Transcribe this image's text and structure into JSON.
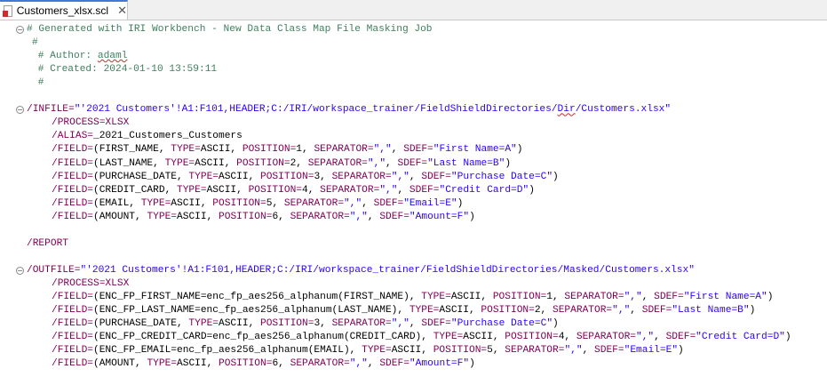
{
  "tab": {
    "filename": "Customers_xlsx.scl",
    "close_glyph": "✕",
    "file_icon": "file-scl-icon"
  },
  "editor": {
    "lines": [
      {
        "fold": true,
        "indent": 0,
        "tokens": [
          {
            "t": "c",
            "v": "# Generated with IRI Workbench - New Data Class Map File Masking Job"
          }
        ]
      },
      {
        "indent": 1,
        "tokens": [
          {
            "t": "c",
            "v": "#"
          }
        ]
      },
      {
        "indent": 1,
        "tokens": [
          {
            "t": "c",
            "v": " # Author: "
          },
          {
            "t": "c",
            "v": "adaml",
            "sq": true
          }
        ]
      },
      {
        "indent": 1,
        "tokens": [
          {
            "t": "c",
            "v": " # Created: 2024-01-10 13:59:11"
          }
        ]
      },
      {
        "indent": 1,
        "tokens": [
          {
            "t": "c",
            "v": " #"
          }
        ]
      },
      {
        "indent": 0,
        "tokens": []
      },
      {
        "fold": true,
        "indent": 0,
        "tokens": [
          {
            "t": "k",
            "v": "/INFILE="
          },
          {
            "t": "s",
            "v": "\"'2021 Customers'!A1:F101,HEADER;C:/IRI/workspace_trainer/FieldShieldDirectories/"
          },
          {
            "t": "s",
            "v": "Dir",
            "sq": true
          },
          {
            "t": "s",
            "v": "/Customers.xlsx\""
          }
        ]
      },
      {
        "indent": 2,
        "tokens": [
          {
            "t": "k",
            "v": "/PROCESS=XLSX"
          }
        ]
      },
      {
        "indent": 2,
        "tokens": [
          {
            "t": "k",
            "v": "/ALIAS="
          },
          {
            "t": "p",
            "v": "_2021_Customers_Customers"
          }
        ]
      },
      {
        "indent": 2,
        "tokens": [
          {
            "t": "k",
            "v": "/FIELD="
          },
          {
            "t": "p",
            "v": "(FIRST_NAME, "
          },
          {
            "t": "k",
            "v": "TYPE="
          },
          {
            "t": "p",
            "v": "ASCII, "
          },
          {
            "t": "k",
            "v": "POSITION="
          },
          {
            "t": "p",
            "v": "1, "
          },
          {
            "t": "k",
            "v": "SEPARATOR="
          },
          {
            "t": "s",
            "v": "\",\""
          },
          {
            "t": "p",
            "v": ", "
          },
          {
            "t": "k",
            "v": "SDEF="
          },
          {
            "t": "s",
            "v": "\"First Name=A\""
          },
          {
            "t": "p",
            "v": ")"
          }
        ]
      },
      {
        "indent": 2,
        "tokens": [
          {
            "t": "k",
            "v": "/FIELD="
          },
          {
            "t": "p",
            "v": "(LAST_NAME, "
          },
          {
            "t": "k",
            "v": "TYPE="
          },
          {
            "t": "p",
            "v": "ASCII, "
          },
          {
            "t": "k",
            "v": "POSITION="
          },
          {
            "t": "p",
            "v": "2, "
          },
          {
            "t": "k",
            "v": "SEPARATOR="
          },
          {
            "t": "s",
            "v": "\",\""
          },
          {
            "t": "p",
            "v": ", "
          },
          {
            "t": "k",
            "v": "SDEF="
          },
          {
            "t": "s",
            "v": "\"Last Name=B\""
          },
          {
            "t": "p",
            "v": ")"
          }
        ]
      },
      {
        "indent": 2,
        "tokens": [
          {
            "t": "k",
            "v": "/FIELD="
          },
          {
            "t": "p",
            "v": "(PURCHASE_DATE, "
          },
          {
            "t": "k",
            "v": "TYPE="
          },
          {
            "t": "p",
            "v": "ASCII, "
          },
          {
            "t": "k",
            "v": "POSITION="
          },
          {
            "t": "p",
            "v": "3, "
          },
          {
            "t": "k",
            "v": "SEPARATOR="
          },
          {
            "t": "s",
            "v": "\",\""
          },
          {
            "t": "p",
            "v": ", "
          },
          {
            "t": "k",
            "v": "SDEF="
          },
          {
            "t": "s",
            "v": "\"Purchase Date=C\""
          },
          {
            "t": "p",
            "v": ")"
          }
        ]
      },
      {
        "indent": 2,
        "tokens": [
          {
            "t": "k",
            "v": "/FIELD="
          },
          {
            "t": "p",
            "v": "(CREDIT_CARD, "
          },
          {
            "t": "k",
            "v": "TYPE="
          },
          {
            "t": "p",
            "v": "ASCII, "
          },
          {
            "t": "k",
            "v": "POSITION="
          },
          {
            "t": "p",
            "v": "4, "
          },
          {
            "t": "k",
            "v": "SEPARATOR="
          },
          {
            "t": "s",
            "v": "\",\""
          },
          {
            "t": "p",
            "v": ", "
          },
          {
            "t": "k",
            "v": "SDEF="
          },
          {
            "t": "s",
            "v": "\"Credit Card=D\""
          },
          {
            "t": "p",
            "v": ")"
          }
        ]
      },
      {
        "indent": 2,
        "tokens": [
          {
            "t": "k",
            "v": "/FIELD="
          },
          {
            "t": "p",
            "v": "(EMAIL, "
          },
          {
            "t": "k",
            "v": "TYPE="
          },
          {
            "t": "p",
            "v": "ASCII, "
          },
          {
            "t": "k",
            "v": "POSITION="
          },
          {
            "t": "p",
            "v": "5, "
          },
          {
            "t": "k",
            "v": "SEPARATOR="
          },
          {
            "t": "s",
            "v": "\",\""
          },
          {
            "t": "p",
            "v": ", "
          },
          {
            "t": "k",
            "v": "SDEF="
          },
          {
            "t": "s",
            "v": "\"Email=E\""
          },
          {
            "t": "p",
            "v": ")"
          }
        ]
      },
      {
        "indent": 2,
        "tokens": [
          {
            "t": "k",
            "v": "/FIELD="
          },
          {
            "t": "p",
            "v": "(AMOUNT, "
          },
          {
            "t": "k",
            "v": "TYPE="
          },
          {
            "t": "p",
            "v": "ASCII, "
          },
          {
            "t": "k",
            "v": "POSITION="
          },
          {
            "t": "p",
            "v": "6, "
          },
          {
            "t": "k",
            "v": "SEPARATOR="
          },
          {
            "t": "s",
            "v": "\",\""
          },
          {
            "t": "p",
            "v": ", "
          },
          {
            "t": "k",
            "v": "SDEF="
          },
          {
            "t": "s",
            "v": "\"Amount=F\""
          },
          {
            "t": "p",
            "v": ")"
          }
        ]
      },
      {
        "indent": 0,
        "tokens": []
      },
      {
        "indent": 0,
        "tokens": [
          {
            "t": "k",
            "v": "/REPORT"
          }
        ]
      },
      {
        "indent": 0,
        "tokens": []
      },
      {
        "fold": true,
        "indent": 0,
        "tokens": [
          {
            "t": "k",
            "v": "/OUTFILE="
          },
          {
            "t": "s",
            "v": "\"'2021 Customers'!A1:F101,HEADER;C:/IRI/workspace_trainer/FieldShieldDirectories/Masked/Customers.xlsx\""
          }
        ]
      },
      {
        "indent": 2,
        "tokens": [
          {
            "t": "k",
            "v": "/PROCESS=XLSX"
          }
        ]
      },
      {
        "indent": 2,
        "tokens": [
          {
            "t": "k",
            "v": "/FIELD="
          },
          {
            "t": "p",
            "v": "(ENC_FP_FIRST_NAME=enc_fp_aes256_alphanum(FIRST_NAME), "
          },
          {
            "t": "k",
            "v": "TYPE="
          },
          {
            "t": "p",
            "v": "ASCII, "
          },
          {
            "t": "k",
            "v": "POSITION="
          },
          {
            "t": "p",
            "v": "1, "
          },
          {
            "t": "k",
            "v": "SEPARATOR="
          },
          {
            "t": "s",
            "v": "\",\""
          },
          {
            "t": "p",
            "v": ", "
          },
          {
            "t": "k",
            "v": "SDEF="
          },
          {
            "t": "s",
            "v": "\"First Name=A\""
          },
          {
            "t": "p",
            "v": ")"
          }
        ]
      },
      {
        "indent": 2,
        "tokens": [
          {
            "t": "k",
            "v": "/FIELD="
          },
          {
            "t": "p",
            "v": "(ENC_FP_LAST_NAME=enc_fp_aes256_alphanum(LAST_NAME), "
          },
          {
            "t": "k",
            "v": "TYPE="
          },
          {
            "t": "p",
            "v": "ASCII, "
          },
          {
            "t": "k",
            "v": "POSITION="
          },
          {
            "t": "p",
            "v": "2, "
          },
          {
            "t": "k",
            "v": "SEPARATOR="
          },
          {
            "t": "s",
            "v": "\",\""
          },
          {
            "t": "p",
            "v": ", "
          },
          {
            "t": "k",
            "v": "SDEF="
          },
          {
            "t": "s",
            "v": "\"Last Name=B\""
          },
          {
            "t": "p",
            "v": ")"
          }
        ]
      },
      {
        "indent": 2,
        "tokens": [
          {
            "t": "k",
            "v": "/FIELD="
          },
          {
            "t": "p",
            "v": "(PURCHASE_DATE, "
          },
          {
            "t": "k",
            "v": "TYPE="
          },
          {
            "t": "p",
            "v": "ASCII, "
          },
          {
            "t": "k",
            "v": "POSITION="
          },
          {
            "t": "p",
            "v": "3, "
          },
          {
            "t": "k",
            "v": "SEPARATOR="
          },
          {
            "t": "s",
            "v": "\",\""
          },
          {
            "t": "p",
            "v": ", "
          },
          {
            "t": "k",
            "v": "SDEF="
          },
          {
            "t": "s",
            "v": "\"Purchase Date=C\""
          },
          {
            "t": "p",
            "v": ")"
          }
        ]
      },
      {
        "indent": 2,
        "tokens": [
          {
            "t": "k",
            "v": "/FIELD="
          },
          {
            "t": "p",
            "v": "(ENC_FP_CREDIT_CARD=enc_fp_aes256_alphanum(CREDIT_CARD), "
          },
          {
            "t": "k",
            "v": "TYPE="
          },
          {
            "t": "p",
            "v": "ASCII, "
          },
          {
            "t": "k",
            "v": "POSITION="
          },
          {
            "t": "p",
            "v": "4, "
          },
          {
            "t": "k",
            "v": "SEPARATOR="
          },
          {
            "t": "s",
            "v": "\",\""
          },
          {
            "t": "p",
            "v": ", "
          },
          {
            "t": "k",
            "v": "SDEF="
          },
          {
            "t": "s",
            "v": "\"Credit Card=D\""
          },
          {
            "t": "p",
            "v": ")"
          }
        ]
      },
      {
        "indent": 2,
        "tokens": [
          {
            "t": "k",
            "v": "/FIELD="
          },
          {
            "t": "p",
            "v": "(ENC_FP_EMAIL=enc_fp_aes256_alphanum(EMAIL), "
          },
          {
            "t": "k",
            "v": "TYPE="
          },
          {
            "t": "p",
            "v": "ASCII, "
          },
          {
            "t": "k",
            "v": "POSITION="
          },
          {
            "t": "p",
            "v": "5, "
          },
          {
            "t": "k",
            "v": "SEPARATOR="
          },
          {
            "t": "s",
            "v": "\",\""
          },
          {
            "t": "p",
            "v": ", "
          },
          {
            "t": "k",
            "v": "SDEF="
          },
          {
            "t": "s",
            "v": "\"Email=E\""
          },
          {
            "t": "p",
            "v": ")"
          }
        ]
      },
      {
        "indent": 2,
        "tokens": [
          {
            "t": "k",
            "v": "/FIELD="
          },
          {
            "t": "p",
            "v": "(AMOUNT, "
          },
          {
            "t": "k",
            "v": "TYPE="
          },
          {
            "t": "p",
            "v": "ASCII, "
          },
          {
            "t": "k",
            "v": "POSITION="
          },
          {
            "t": "p",
            "v": "6, "
          },
          {
            "t": "k",
            "v": "SEPARATOR="
          },
          {
            "t": "s",
            "v": "\",\""
          },
          {
            "t": "p",
            "v": ", "
          },
          {
            "t": "k",
            "v": "SDEF="
          },
          {
            "t": "s",
            "v": "\"Amount=F\""
          },
          {
            "t": "p",
            "v": ")"
          }
        ]
      }
    ]
  },
  "colors": {
    "comment": "#3f7f5f",
    "keyword": "#7f0055",
    "string": "#2a00ff",
    "tab_accent": "#3d7bd6"
  }
}
